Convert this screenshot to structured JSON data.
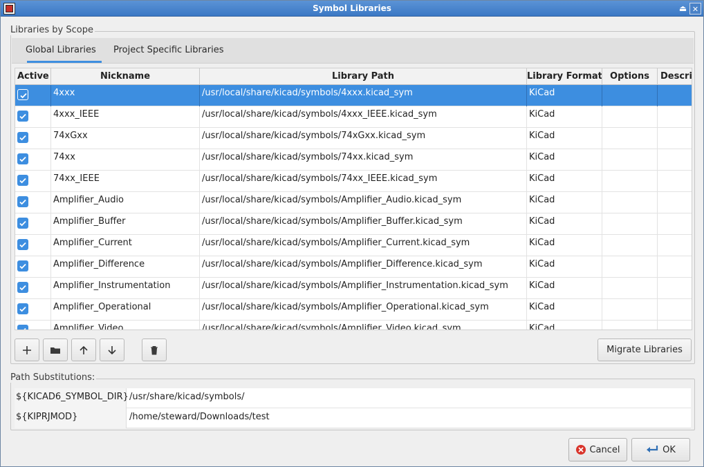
{
  "window": {
    "title": "Symbol Libraries"
  },
  "libraries_group": {
    "label": "Libraries by Scope"
  },
  "tabs": [
    {
      "label": "Global Libraries",
      "selected": true
    },
    {
      "label": "Project Specific Libraries",
      "selected": false
    }
  ],
  "grid": {
    "columns": [
      "Active",
      "Nickname",
      "Library Path",
      "Library Format",
      "Options",
      "Descrip"
    ],
    "rows": [
      {
        "active": true,
        "nickname": "4xxx",
        "path": "/usr/local/share/kicad/symbols/4xxx.kicad_sym",
        "format": "KiCad",
        "selected": true
      },
      {
        "active": true,
        "nickname": "4xxx_IEEE",
        "path": "/usr/local/share/kicad/symbols/4xxx_IEEE.kicad_sym",
        "format": "KiCad"
      },
      {
        "active": true,
        "nickname": "74xGxx",
        "path": "/usr/local/share/kicad/symbols/74xGxx.kicad_sym",
        "format": "KiCad"
      },
      {
        "active": true,
        "nickname": "74xx",
        "path": "/usr/local/share/kicad/symbols/74xx.kicad_sym",
        "format": "KiCad"
      },
      {
        "active": true,
        "nickname": "74xx_IEEE",
        "path": "/usr/local/share/kicad/symbols/74xx_IEEE.kicad_sym",
        "format": "KiCad"
      },
      {
        "active": true,
        "nickname": "Amplifier_Audio",
        "path": "/usr/local/share/kicad/symbols/Amplifier_Audio.kicad_sym",
        "format": "KiCad"
      },
      {
        "active": true,
        "nickname": "Amplifier_Buffer",
        "path": "/usr/local/share/kicad/symbols/Amplifier_Buffer.kicad_sym",
        "format": "KiCad"
      },
      {
        "active": true,
        "nickname": "Amplifier_Current",
        "path": "/usr/local/share/kicad/symbols/Amplifier_Current.kicad_sym",
        "format": "KiCad"
      },
      {
        "active": true,
        "nickname": "Amplifier_Difference",
        "path": "/usr/local/share/kicad/symbols/Amplifier_Difference.kicad_sym",
        "format": "KiCad"
      },
      {
        "active": true,
        "nickname": "Amplifier_Instrumentation",
        "path": "/usr/local/share/kicad/symbols/Amplifier_Instrumentation.kicad_sym",
        "format": "KiCad"
      },
      {
        "active": true,
        "nickname": "Amplifier_Operational",
        "path": "/usr/local/share/kicad/symbols/Amplifier_Operational.kicad_sym",
        "format": "KiCad"
      },
      {
        "active": true,
        "nickname": "Amplifier_Video",
        "path": "/usr/local/share/kicad/symbols/Amplifier_Video.kicad_sym",
        "format": "KiCad"
      }
    ]
  },
  "toolbar": {
    "buttons": [
      "add-icon",
      "folder-icon",
      "move-up-icon",
      "move-down-icon",
      "trash-icon"
    ],
    "migrate_label": "Migrate Libraries"
  },
  "substitutions": {
    "label": "Path Substitutions:",
    "rows": [
      {
        "key": "${KICAD6_SYMBOL_DIR}",
        "value": "/usr/share/kicad/symbols/"
      },
      {
        "key": "${KIPRJMOD}",
        "value": "/home/steward/Downloads/test"
      }
    ]
  },
  "buttons": {
    "cancel": "Cancel",
    "ok": "OK"
  },
  "colors": {
    "accent": "#3d8ee0",
    "titlebar": "#4a84cc",
    "cancel_icon": "#d9342b"
  }
}
